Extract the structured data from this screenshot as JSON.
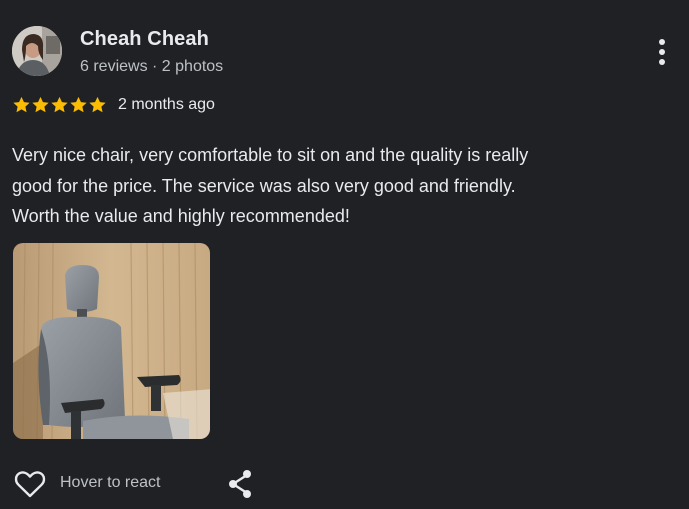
{
  "reviewer": {
    "name": "Cheah Cheah",
    "meta": "6 reviews · 2 photos"
  },
  "rating": {
    "stars": 5,
    "max_stars": 5,
    "star_color": "#fbbc04",
    "time_ago": "2 months ago"
  },
  "review": {
    "lines": [
      "Very nice chair, very comfortable to sit on and the quality is really",
      "good for the price. The service was also very good and friendly.",
      "Worth the value and highly recommended!"
    ]
  },
  "photos": [
    {
      "subject": "grey ergonomic office chair with headrest"
    }
  ],
  "actions": {
    "react_label": "Hover to react",
    "like_icon": "heart-outline-icon",
    "share_icon": "share-icon"
  },
  "menu": {
    "icon": "more-vertical-icon"
  },
  "colors": {
    "background": "#202124",
    "text_primary": "#e8eaed",
    "text_secondary": "#bdc1c6"
  }
}
